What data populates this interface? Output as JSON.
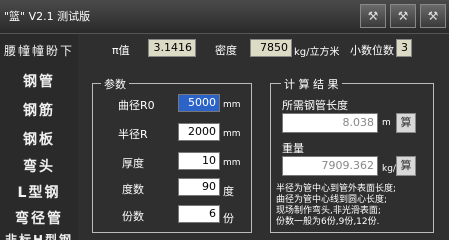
{
  "window": {
    "title": "\"篮\" V2.1 测试版"
  },
  "titlebar": {
    "buttons": [
      "⚒",
      "⚒",
      "⚒"
    ]
  },
  "sidebar": {
    "items": [
      "腰幢幢盼下",
      "钢管",
      "钢筋",
      "钢板",
      "弯头",
      "L型钢",
      "弯径管",
      "非标H型钢"
    ]
  },
  "params": {
    "pi_label": "π值",
    "pi_value": "3.1416",
    "density_label": "密度",
    "density_value": "7850",
    "density_unit": "kg/立方米",
    "decimals_label": "小数位数",
    "decimals_value": "3"
  },
  "param_group": {
    "title": "参数",
    "rows": [
      {
        "label": "曲径R0",
        "value": "5000",
        "unit": "mm"
      },
      {
        "label": "半径R",
        "value": "2000",
        "unit": "mm"
      },
      {
        "label": "厚度",
        "value": "10",
        "unit": "mm"
      },
      {
        "label": "度数",
        "value": "90",
        "unit": "度"
      },
      {
        "label": "份数",
        "value": "6",
        "unit": "份"
      }
    ]
  },
  "result_group": {
    "title": "计 算 结 果",
    "length_label": "所需钢管长度",
    "length_value": "8.038",
    "length_unit": "m",
    "weight_label": "重量",
    "weight_value": "7909.362",
    "weight_unit": "kg/个",
    "calc_label": "算",
    "notes": [
      "半径为管中心到管外表面长度;",
      "曲径为管中心线到圆心长度;",
      "现场制作弯头,非光滑表面;",
      "份数一般为6份,9份,12份."
    ]
  }
}
